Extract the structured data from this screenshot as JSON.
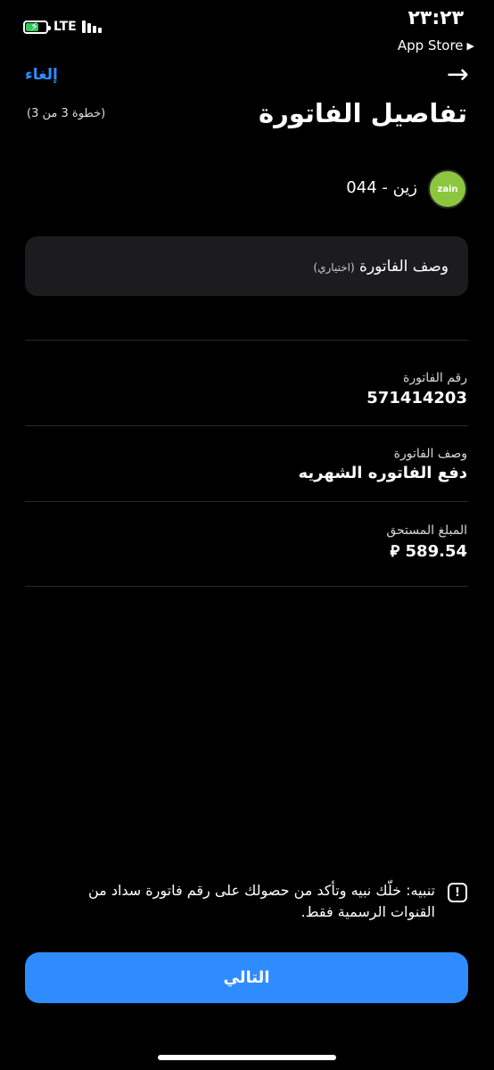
{
  "status_bar": {
    "time": "٢٣:٢٣",
    "back_app": "App Store",
    "back_glyph": "▶",
    "network": "LTE"
  },
  "header": {
    "cancel": "إلغاء",
    "back_arrow": "→",
    "title": "تفاصيل الفاتورة",
    "step": "(خطوة 3 من 3)"
  },
  "biller": {
    "logo_text": "zain",
    "name": "044 - زين"
  },
  "description_input": {
    "label": "وصف الفاتورة",
    "optional": "(اختياري)"
  },
  "fields": {
    "bill_number_label": "رقم الفاتورة",
    "bill_number_value": "571414203",
    "bill_desc_label": "وصف الفاتورة",
    "bill_desc_value": "دفع الفاتوره الشهريه",
    "amount_label": "المبلغ المستحق",
    "amount_value": "589.54",
    "currency_symbol": "⃁"
  },
  "warning": {
    "icon": "!",
    "text": "تنبيه: خلّك نبيه وتأكد من حصولك على رقم فاتورة سداد من القنوات الرسمية فقط."
  },
  "next_button": "التالي",
  "colors": {
    "accent": "#2f8cff",
    "card": "#1c1c1e",
    "battery": "#34c759",
    "zain_logo": "#8cc63f"
  }
}
